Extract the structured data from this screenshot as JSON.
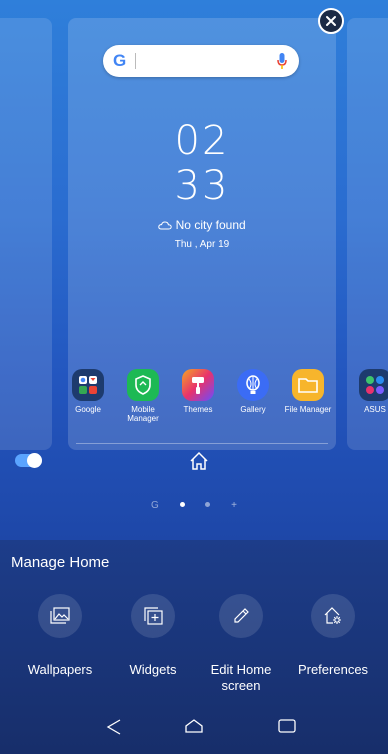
{
  "search": {
    "logo": "G",
    "mic_icon": "mic-icon"
  },
  "clock": {
    "hours": "02",
    "minutes": "33"
  },
  "weather": {
    "text": "No city found",
    "icon": "cloud-icon"
  },
  "date": "Thu , Apr 19",
  "apps": [
    {
      "label": "Google"
    },
    {
      "label": "Mobile Manager"
    },
    {
      "label": "Themes"
    },
    {
      "label": "Gallery"
    },
    {
      "label": "File Manager"
    },
    {
      "label": "ASUS"
    }
  ],
  "page_indicator": {
    "g": "G",
    "plus": "+"
  },
  "sheet": {
    "title": "Manage Home",
    "options": [
      {
        "label": "Wallpapers"
      },
      {
        "label": "Widgets"
      },
      {
        "label": "Edit Home screen"
      },
      {
        "label": "Preferences"
      }
    ]
  },
  "colors": {
    "wall_top": "#2f7fda",
    "wall_bottom": "#1e47a8",
    "sheet": "#1d3d8a",
    "accent": "#5aa4ff"
  }
}
